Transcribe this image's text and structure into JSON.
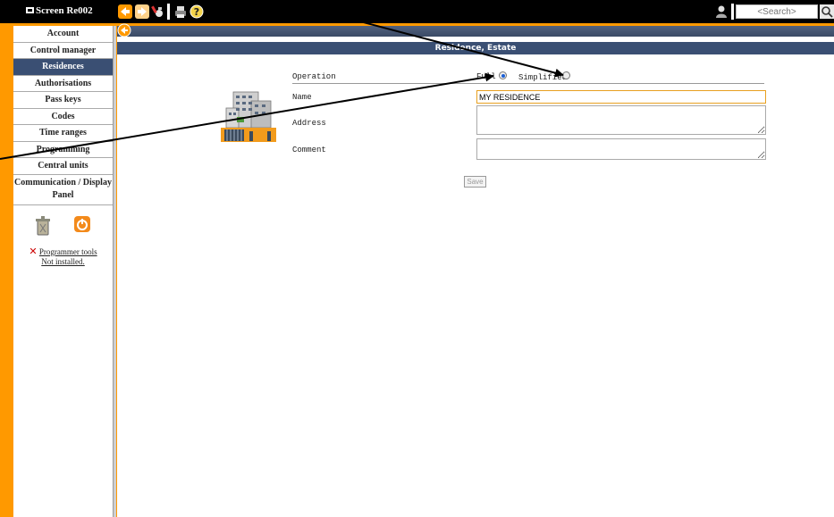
{
  "window": {
    "title": "Screen Re002"
  },
  "toolbar": {
    "icons": [
      "back-arrow-icon",
      "forward-arrow-icon",
      "tools-icon",
      "print-icon",
      "help-icon",
      "user-icon",
      "search-icon"
    ],
    "search_placeholder": "<Search>"
  },
  "sidebar": {
    "items": [
      {
        "label": "Account"
      },
      {
        "label": "Control manager"
      },
      {
        "label": "Residences"
      },
      {
        "label": "Authorisations"
      },
      {
        "label": "Pass keys"
      },
      {
        "label": "Codes"
      },
      {
        "label": "Time ranges"
      },
      {
        "label": "Programming"
      },
      {
        "label": "Central units"
      },
      {
        "label": "Communication / Display Panel"
      }
    ],
    "active_item": "Residences",
    "programmer_tools_link": "Programmer tools",
    "programmer_tools_status": "Not installed."
  },
  "main": {
    "title": "Residence, Estate",
    "form": {
      "operation_label": "Operation",
      "option_full": "Full",
      "option_simplified": "Simplified",
      "selected_option": "Full",
      "name_label": "Name",
      "name_value": "MY RESIDENCE",
      "address_label": "Address",
      "address_value": "",
      "comment_label": "Comment",
      "comment_value": "",
      "save_label": "Save"
    }
  },
  "colors": {
    "background": "#ff9900",
    "header": "#000000",
    "accent": "#3a4f73",
    "active_item": "#3a4f73",
    "input_focus_border": "#e8a020"
  }
}
